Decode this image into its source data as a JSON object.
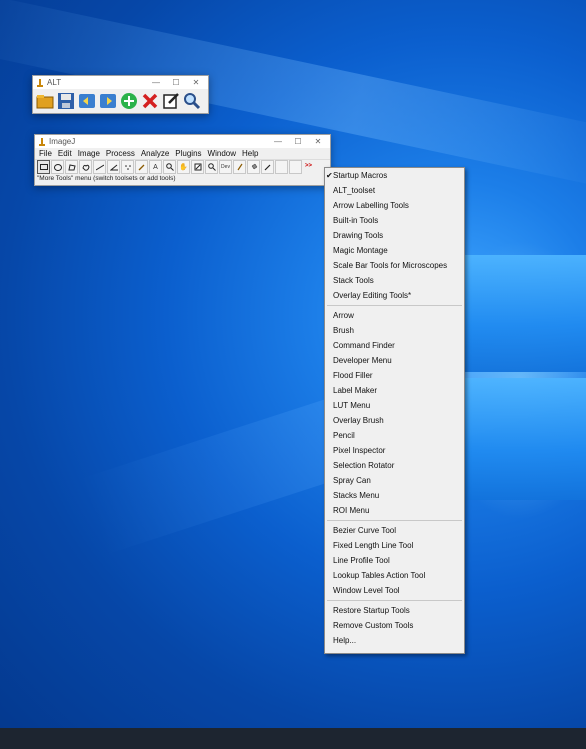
{
  "alt_window": {
    "title": "ALT",
    "tools": [
      {
        "icon": "open-folder-icon"
      },
      {
        "icon": "save-floppy-icon"
      },
      {
        "icon": "import-arrow-icon"
      },
      {
        "icon": "export-arrow-icon"
      },
      {
        "icon": "add-plus-icon"
      },
      {
        "icon": "delete-x-icon"
      },
      {
        "icon": "edit-pencil-icon"
      },
      {
        "icon": "zoom-magnifier-icon"
      }
    ]
  },
  "imagej_window": {
    "title": "ImageJ",
    "menus": [
      "File",
      "Edit",
      "Image",
      "Process",
      "Analyze",
      "Plugins",
      "Window",
      "Help"
    ],
    "tool_dev_label": "Dev",
    "more_label": ">>",
    "status": "\"More Tools\" menu (switch toolsets or add tools)"
  },
  "dropdown": {
    "group1": [
      "Startup Macros",
      "ALT_toolset",
      "Arrow Labelling Tools",
      "Built-in Tools",
      "Drawing Tools",
      "Magic Montage",
      "Scale Bar Tools for Microscopes",
      "Stack Tools",
      "Overlay Editing Tools*"
    ],
    "checked": "Startup Macros",
    "group2": [
      "Arrow",
      "Brush",
      "Command Finder",
      "Developer Menu",
      "Flood Filler",
      "Label Maker",
      "LUT Menu",
      "Overlay Brush",
      "Pencil",
      "Pixel Inspector",
      "Selection Rotator",
      "Spray Can",
      "Stacks Menu",
      "ROI Menu"
    ],
    "group3": [
      "Bezier Curve Tool",
      "Fixed Length Line Tool",
      "Line Profile Tool",
      "Lookup Tables Action Tool",
      "Window Level Tool"
    ],
    "group4": [
      "Restore Startup Tools",
      "Remove Custom Tools",
      "Help..."
    ]
  },
  "colors": {
    "desktop": "#0b5fce",
    "taskbar": "#1d2530",
    "menu_bg": "#f0f0f0",
    "more_red": "#cc0000"
  }
}
